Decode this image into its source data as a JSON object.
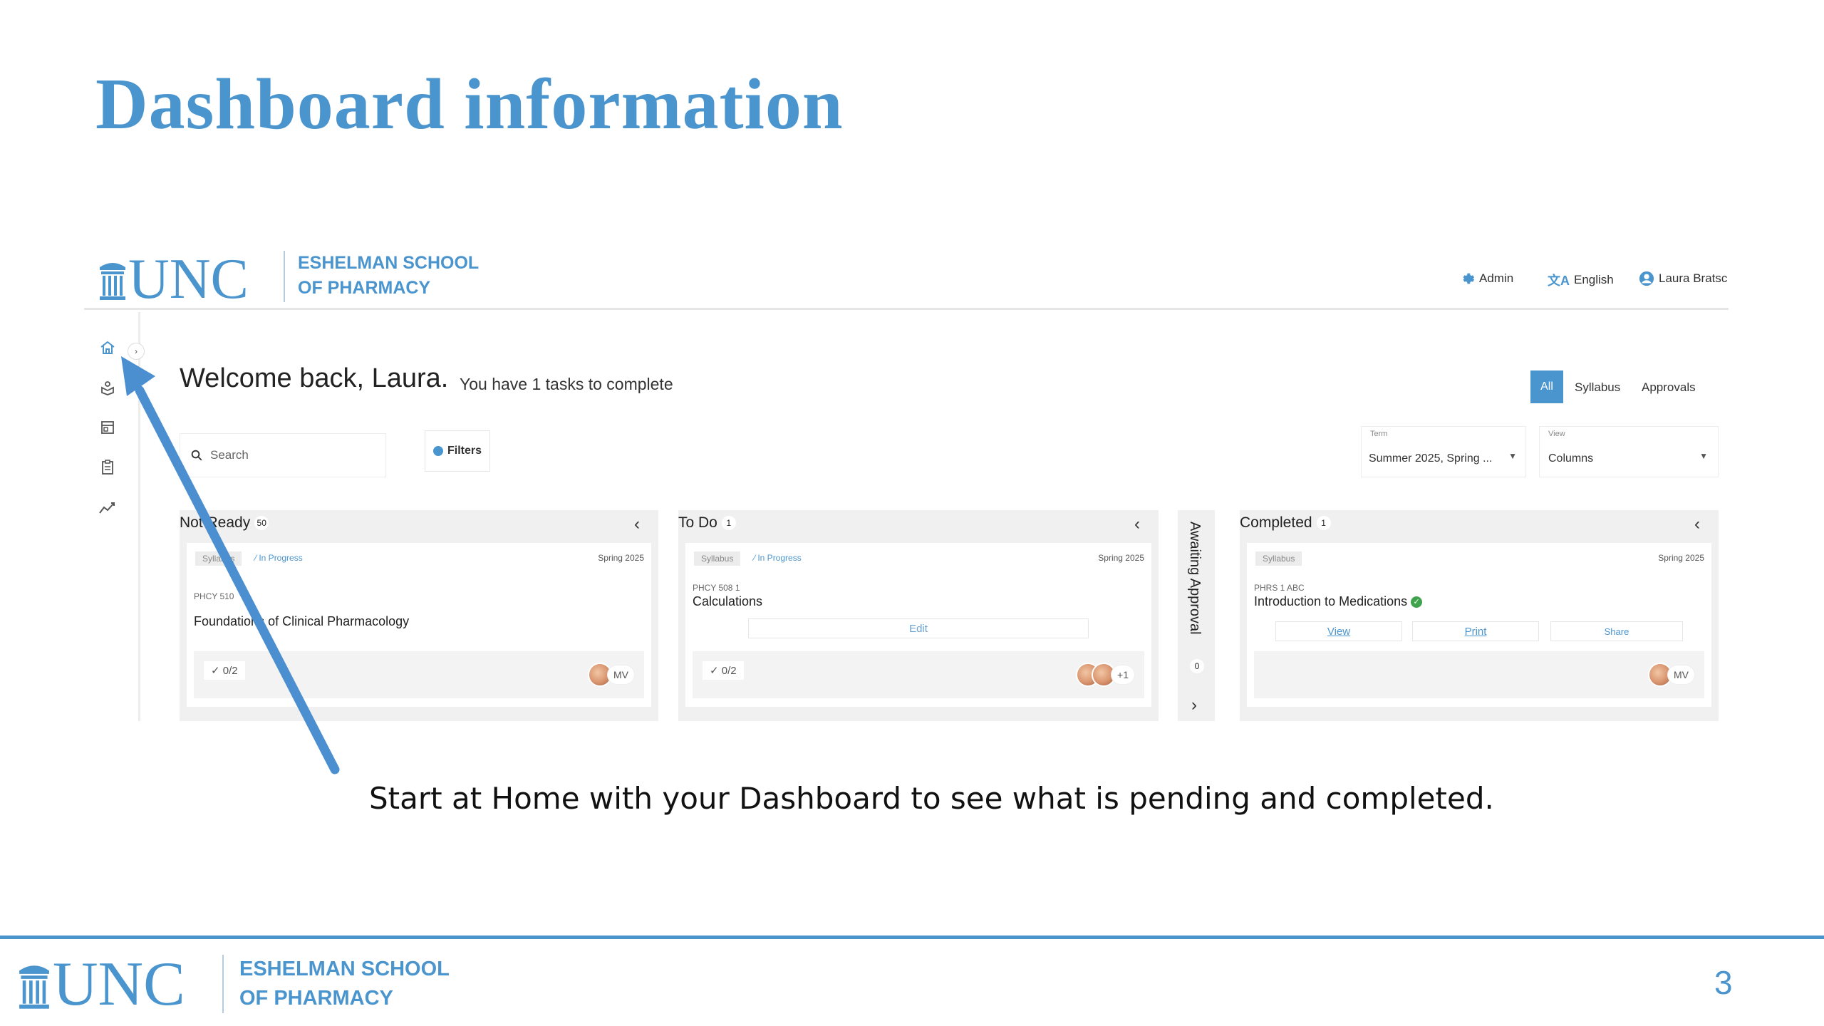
{
  "slide": {
    "title": "Dashboard information",
    "caption": "Start at Home with your Dashboard to see what is pending and completed.",
    "page_number": "3"
  },
  "logo": {
    "unc": "UNC",
    "school_line1": "ESHELMAN SCHOOL",
    "school_line2": "OF PHARMACY"
  },
  "topnav": {
    "admin": "Admin",
    "language": "English",
    "user": "Laura Bratsc"
  },
  "welcome": {
    "greeting": "Welcome back, Laura.",
    "tasks_note": "You have 1 tasks to complete"
  },
  "filters_tabs": {
    "all": "All",
    "syllabus": "Syllabus",
    "approvals": "Approvals"
  },
  "search": {
    "placeholder": "Search"
  },
  "filters_button": "Filters",
  "term_select": {
    "label": "Term",
    "value": "Summer 2025, Spring ..."
  },
  "view_select": {
    "label": "View",
    "value": "Columns"
  },
  "columns": {
    "not_ready": {
      "title": "Not Ready",
      "count": "50",
      "card": {
        "tag": "Syllabus",
        "status": "In Progress",
        "term": "Spring 2025",
        "code": "PHCY 510",
        "title": "Foundations of Clinical Pharmacology",
        "check": "0/2",
        "avatar_initials": "MV"
      }
    },
    "todo": {
      "title": "To Do",
      "count": "1",
      "card": {
        "tag": "Syllabus",
        "status": "In Progress",
        "term": "Spring 2025",
        "code": "PHCY 508 1",
        "title": "Calculations",
        "edit": "Edit",
        "check": "0/2",
        "avatar_more": "+1"
      }
    },
    "awaiting": {
      "title": "Awaiting Approval",
      "count": "0"
    },
    "completed": {
      "title": "Completed",
      "count": "1",
      "card": {
        "tag": "Syllabus",
        "term": "Spring 2025",
        "code": "PHRS 1 ABC",
        "title": "Introduction to Medications",
        "view": "View",
        "print": "Print",
        "share": "Share",
        "avatar_initials": "MV"
      }
    }
  },
  "icons": {
    "sidebar": [
      "home-icon",
      "box-icon",
      "calendar-icon",
      "clipboard-icon",
      "analytics-icon"
    ],
    "accent": "#4b95cf"
  }
}
